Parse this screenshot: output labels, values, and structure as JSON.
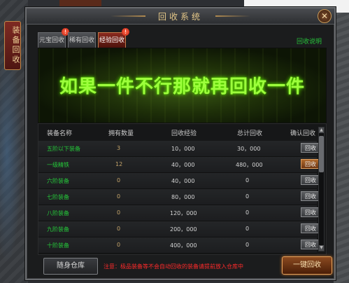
{
  "side_tab": {
    "label": "装备回收"
  },
  "window": {
    "title": "回收系统",
    "close_icon": "close-icon"
  },
  "tabs": [
    {
      "label": "元宝回收",
      "badge": "!"
    },
    {
      "label": "稀有回收",
      "badge": ""
    },
    {
      "label": "经验回收",
      "badge": "!"
    }
  ],
  "help_link": "回收说明",
  "banner": {
    "text": "如果一件不行那就再回收一件"
  },
  "table": {
    "headers": [
      "装备名称",
      "拥有数量",
      "回收经验",
      "总计回收",
      "确认回收"
    ],
    "rows": [
      {
        "name": "五阶以下装备",
        "count": "3",
        "exp": "10，000",
        "total": "30，000",
        "action": "回收"
      },
      {
        "name": "一级精铁",
        "count": "12",
        "exp": "40，000",
        "total": "480，000",
        "action": "回收"
      },
      {
        "name": "六阶装备",
        "count": "0",
        "exp": "40，000",
        "total": "0",
        "action": "回收"
      },
      {
        "name": "七阶装备",
        "count": "0",
        "exp": "80，000",
        "total": "0",
        "action": "回收"
      },
      {
        "name": "八阶装备",
        "count": "0",
        "exp": "120，000",
        "total": "0",
        "action": "回收"
      },
      {
        "name": "九阶装备",
        "count": "0",
        "exp": "200，000",
        "total": "0",
        "action": "回收"
      },
      {
        "name": "十阶装备",
        "count": "0",
        "exp": "400，000",
        "total": "0",
        "action": "回收"
      }
    ]
  },
  "footer": {
    "warehouse_button": "随身仓库",
    "notice": "注意：极品装备等不会自动回收的装备请提前放入仓库中",
    "recycle_all_button": "一键回收"
  }
}
